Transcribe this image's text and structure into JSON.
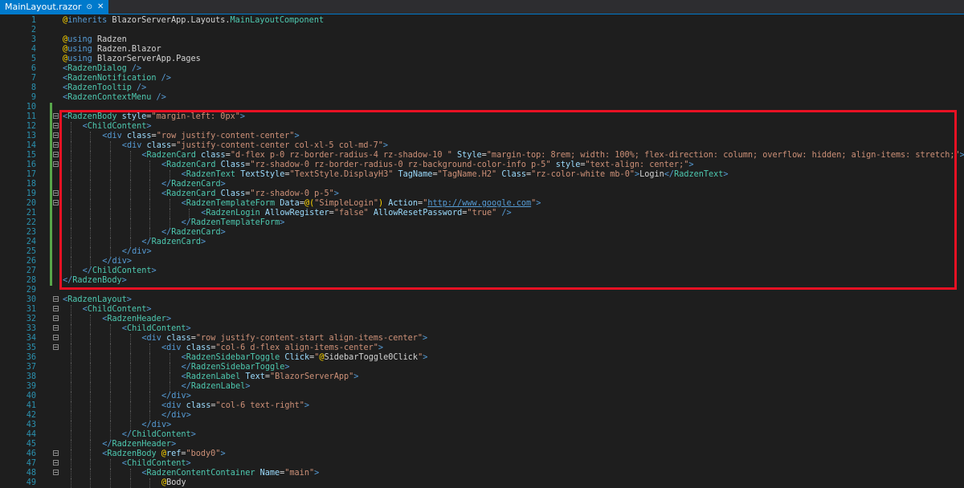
{
  "tab": {
    "title": "MainLayout.razor"
  },
  "colors": {
    "tab_bg": "#007acc",
    "highlight": "#e81123",
    "change_bar": "#57a64a"
  },
  "lines": [
    {
      "n": "1",
      "indent": 0,
      "fold": false,
      "tokens": [
        [
          "at",
          "@"
        ],
        [
          "k",
          "inherits "
        ],
        [
          "d",
          "BlazorServerApp.Layouts."
        ],
        [
          "t",
          "MainLayoutComponent"
        ]
      ]
    },
    {
      "n": "2",
      "indent": 0,
      "fold": false,
      "tokens": []
    },
    {
      "n": "3",
      "indent": 0,
      "fold": false,
      "tokens": [
        [
          "at",
          "@"
        ],
        [
          "k",
          "using "
        ],
        [
          "d",
          "Radzen"
        ]
      ]
    },
    {
      "n": "4",
      "indent": 0,
      "fold": false,
      "tokens": [
        [
          "at",
          "@"
        ],
        [
          "k",
          "using "
        ],
        [
          "d",
          "Radzen.Blazor"
        ]
      ]
    },
    {
      "n": "5",
      "indent": 0,
      "fold": false,
      "tokens": [
        [
          "at",
          "@"
        ],
        [
          "k",
          "using "
        ],
        [
          "d",
          "BlazorServerApp.Pages"
        ]
      ]
    },
    {
      "n": "6",
      "indent": 0,
      "fold": false,
      "tokens": [
        [
          "k",
          "<"
        ],
        [
          "t",
          "RadzenDialog"
        ],
        [
          "k",
          " />"
        ]
      ]
    },
    {
      "n": "7",
      "indent": 0,
      "fold": false,
      "tokens": [
        [
          "k",
          "<"
        ],
        [
          "t",
          "RadzenNotification"
        ],
        [
          "k",
          " />"
        ]
      ]
    },
    {
      "n": "8",
      "indent": 0,
      "fold": false,
      "tokens": [
        [
          "k",
          "<"
        ],
        [
          "t",
          "RadzenTooltip"
        ],
        [
          "k",
          " />"
        ]
      ]
    },
    {
      "n": "9",
      "indent": 0,
      "fold": false,
      "tokens": [
        [
          "k",
          "<"
        ],
        [
          "t",
          "RadzenContextMenu"
        ],
        [
          "k",
          " />"
        ]
      ]
    },
    {
      "n": "10",
      "indent": 0,
      "fold": false,
      "tokens": []
    },
    {
      "n": "11",
      "indent": 0,
      "fold": true,
      "tokens": [
        [
          "k",
          "<"
        ],
        [
          "t",
          "RadzenBody"
        ],
        [
          "a",
          " style"
        ],
        [
          "d",
          "="
        ],
        [
          "s",
          "\"margin-left: 0px\""
        ],
        [
          "k",
          ">"
        ]
      ]
    },
    {
      "n": "12",
      "indent": 1,
      "fold": true,
      "tokens": [
        [
          "k",
          "<"
        ],
        [
          "t",
          "ChildContent"
        ],
        [
          "k",
          ">"
        ]
      ]
    },
    {
      "n": "13",
      "indent": 2,
      "fold": true,
      "tokens": [
        [
          "k",
          "<"
        ],
        [
          "k",
          "div"
        ],
        [
          "a",
          " class"
        ],
        [
          "d",
          "="
        ],
        [
          "s",
          "\"row justify-content-center\""
        ],
        [
          "k",
          ">"
        ]
      ]
    },
    {
      "n": "14",
      "indent": 3,
      "fold": true,
      "tokens": [
        [
          "k",
          "<"
        ],
        [
          "k",
          "div"
        ],
        [
          "a",
          " class"
        ],
        [
          "d",
          "="
        ],
        [
          "s",
          "\"justify-content-center col-xl-5 col-md-7\""
        ],
        [
          "k",
          ">"
        ]
      ]
    },
    {
      "n": "15",
      "indent": 4,
      "fold": true,
      "tokens": [
        [
          "k",
          "<"
        ],
        [
          "t",
          "RadzenCard"
        ],
        [
          "a",
          " class"
        ],
        [
          "d",
          "="
        ],
        [
          "s",
          "\"d-flex p-0 rz-border-radius-4 rz-shadow-10 \""
        ],
        [
          "a",
          " Style"
        ],
        [
          "d",
          "="
        ],
        [
          "s",
          "\"margin-top: 8rem; width: 100%; flex-direction: column; overflow: hidden; align-items: stretch;\""
        ],
        [
          "k",
          ">"
        ]
      ]
    },
    {
      "n": "16",
      "indent": 5,
      "fold": true,
      "tokens": [
        [
          "k",
          "<"
        ],
        [
          "t",
          "RadzenCard"
        ],
        [
          "a",
          " Class"
        ],
        [
          "d",
          "="
        ],
        [
          "s",
          "\"rz-shadow-0 rz-border-radius-0 rz-background-color-info p-5\""
        ],
        [
          "a",
          " style"
        ],
        [
          "d",
          "="
        ],
        [
          "s",
          "\"text-align: center;\""
        ],
        [
          "k",
          ">"
        ]
      ]
    },
    {
      "n": "17",
      "indent": 6,
      "fold": false,
      "tokens": [
        [
          "k",
          "<"
        ],
        [
          "t",
          "RadzenText"
        ],
        [
          "a",
          " TextStyle"
        ],
        [
          "d",
          "="
        ],
        [
          "s",
          "\"TextStyle.DisplayH3\""
        ],
        [
          "a",
          " TagName"
        ],
        [
          "d",
          "="
        ],
        [
          "s",
          "\"TagName.H2\""
        ],
        [
          "a",
          " Class"
        ],
        [
          "d",
          "="
        ],
        [
          "s",
          "\"rz-color-white mb-0\""
        ],
        [
          "k",
          ">"
        ],
        [
          "d",
          "Login"
        ],
        [
          "k",
          "</"
        ],
        [
          "t",
          "RadzenText"
        ],
        [
          "k",
          ">"
        ]
      ]
    },
    {
      "n": "18",
      "indent": 5,
      "fold": false,
      "tokens": [
        [
          "k",
          "</"
        ],
        [
          "t",
          "RadzenCard"
        ],
        [
          "k",
          ">"
        ]
      ]
    },
    {
      "n": "19",
      "indent": 5,
      "fold": true,
      "tokens": [
        [
          "k",
          "<"
        ],
        [
          "t",
          "RadzenCard"
        ],
        [
          "a",
          " Class"
        ],
        [
          "d",
          "="
        ],
        [
          "s",
          "\"rz-shadow-0 p-5\""
        ],
        [
          "k",
          ">"
        ]
      ]
    },
    {
      "n": "20",
      "indent": 6,
      "fold": true,
      "tokens": [
        [
          "k",
          "<"
        ],
        [
          "t",
          "RadzenTemplateForm"
        ],
        [
          "a",
          " Data"
        ],
        [
          "d",
          "="
        ],
        [
          "at",
          "@("
        ],
        [
          "s",
          "\"SimpleLogin\""
        ],
        [
          "at",
          ")"
        ],
        [
          "a",
          " Action"
        ],
        [
          "d",
          "="
        ],
        [
          "s",
          "\""
        ],
        [
          "u",
          "http://www.google.com"
        ],
        [
          "s",
          "\""
        ],
        [
          "k",
          ">"
        ]
      ]
    },
    {
      "n": "21",
      "indent": 7,
      "fold": false,
      "tokens": [
        [
          "k",
          "<"
        ],
        [
          "t",
          "RadzenLogin"
        ],
        [
          "a",
          " AllowRegister"
        ],
        [
          "d",
          "="
        ],
        [
          "s",
          "\"false\""
        ],
        [
          "a",
          " AllowResetPassword"
        ],
        [
          "d",
          "="
        ],
        [
          "s",
          "\"true\""
        ],
        [
          "k",
          " />"
        ]
      ]
    },
    {
      "n": "22",
      "indent": 6,
      "fold": false,
      "tokens": [
        [
          "k",
          "</"
        ],
        [
          "t",
          "RadzenTemplateForm"
        ],
        [
          "k",
          ">"
        ]
      ]
    },
    {
      "n": "23",
      "indent": 5,
      "fold": false,
      "tokens": [
        [
          "k",
          "</"
        ],
        [
          "t",
          "RadzenCard"
        ],
        [
          "k",
          ">"
        ]
      ]
    },
    {
      "n": "24",
      "indent": 4,
      "fold": false,
      "tokens": [
        [
          "k",
          "</"
        ],
        [
          "t",
          "RadzenCard"
        ],
        [
          "k",
          ">"
        ]
      ]
    },
    {
      "n": "25",
      "indent": 3,
      "fold": false,
      "tokens": [
        [
          "k",
          "</"
        ],
        [
          "k",
          "div"
        ],
        [
          "k",
          ">"
        ]
      ]
    },
    {
      "n": "26",
      "indent": 2,
      "fold": false,
      "tokens": [
        [
          "k",
          "</"
        ],
        [
          "k",
          "div"
        ],
        [
          "k",
          ">"
        ]
      ]
    },
    {
      "n": "27",
      "indent": 1,
      "fold": false,
      "tokens": [
        [
          "k",
          "</"
        ],
        [
          "t",
          "ChildContent"
        ],
        [
          "k",
          ">"
        ]
      ]
    },
    {
      "n": "28",
      "indent": 0,
      "fold": false,
      "tokens": [
        [
          "k",
          "</"
        ],
        [
          "t",
          "RadzenBody"
        ],
        [
          "k",
          ">"
        ]
      ]
    },
    {
      "n": "29",
      "indent": 0,
      "fold": false,
      "tokens": []
    },
    {
      "n": "30",
      "indent": 0,
      "fold": true,
      "tokens": [
        [
          "k",
          "<"
        ],
        [
          "t",
          "RadzenLayout"
        ],
        [
          "k",
          ">"
        ]
      ]
    },
    {
      "n": "31",
      "indent": 1,
      "fold": true,
      "tokens": [
        [
          "k",
          "<"
        ],
        [
          "t",
          "ChildContent"
        ],
        [
          "k",
          ">"
        ]
      ]
    },
    {
      "n": "32",
      "indent": 2,
      "fold": true,
      "tokens": [
        [
          "k",
          "<"
        ],
        [
          "t",
          "RadzenHeader"
        ],
        [
          "k",
          ">"
        ]
      ]
    },
    {
      "n": "33",
      "indent": 3,
      "fold": true,
      "tokens": [
        [
          "k",
          "<"
        ],
        [
          "t",
          "ChildContent"
        ],
        [
          "k",
          ">"
        ]
      ]
    },
    {
      "n": "34",
      "indent": 4,
      "fold": true,
      "tokens": [
        [
          "k",
          "<"
        ],
        [
          "k",
          "div"
        ],
        [
          "a",
          " class"
        ],
        [
          "d",
          "="
        ],
        [
          "s",
          "\"row justify-content-start align-items-center\""
        ],
        [
          "k",
          ">"
        ]
      ]
    },
    {
      "n": "35",
      "indent": 5,
      "fold": true,
      "tokens": [
        [
          "k",
          "<"
        ],
        [
          "k",
          "div"
        ],
        [
          "a",
          " class"
        ],
        [
          "d",
          "="
        ],
        [
          "s",
          "\"col-6 d-flex align-items-center\""
        ],
        [
          "k",
          ">"
        ]
      ]
    },
    {
      "n": "36",
      "indent": 6,
      "fold": false,
      "tokens": [
        [
          "k",
          "<"
        ],
        [
          "t",
          "RadzenSidebarToggle"
        ],
        [
          "a",
          " Click"
        ],
        [
          "d",
          "="
        ],
        [
          "s",
          "\""
        ],
        [
          "at",
          "@"
        ],
        [
          "d",
          "SidebarToggle0Click"
        ],
        [
          "s",
          "\""
        ],
        [
          "k",
          ">"
        ]
      ]
    },
    {
      "n": "37",
      "indent": 6,
      "fold": false,
      "tokens": [
        [
          "k",
          "</"
        ],
        [
          "t",
          "RadzenSidebarToggle"
        ],
        [
          "k",
          ">"
        ]
      ]
    },
    {
      "n": "38",
      "indent": 6,
      "fold": false,
      "tokens": [
        [
          "k",
          "<"
        ],
        [
          "t",
          "RadzenLabel"
        ],
        [
          "a",
          " Text"
        ],
        [
          "d",
          "="
        ],
        [
          "s",
          "\"BlazorServerApp\""
        ],
        [
          "k",
          ">"
        ]
      ]
    },
    {
      "n": "39",
      "indent": 6,
      "fold": false,
      "tokens": [
        [
          "k",
          "</"
        ],
        [
          "t",
          "RadzenLabel"
        ],
        [
          "k",
          ">"
        ]
      ]
    },
    {
      "n": "40",
      "indent": 5,
      "fold": false,
      "tokens": [
        [
          "k",
          "</"
        ],
        [
          "k",
          "div"
        ],
        [
          "k",
          ">"
        ]
      ]
    },
    {
      "n": "41",
      "indent": 5,
      "fold": false,
      "tokens": [
        [
          "k",
          "<"
        ],
        [
          "k",
          "div"
        ],
        [
          "a",
          " class"
        ],
        [
          "d",
          "="
        ],
        [
          "s",
          "\"col-6 text-right\""
        ],
        [
          "k",
          ">"
        ]
      ]
    },
    {
      "n": "42",
      "indent": 5,
      "fold": false,
      "tokens": [
        [
          "k",
          "</"
        ],
        [
          "k",
          "div"
        ],
        [
          "k",
          ">"
        ]
      ]
    },
    {
      "n": "43",
      "indent": 4,
      "fold": false,
      "tokens": [
        [
          "k",
          "</"
        ],
        [
          "k",
          "div"
        ],
        [
          "k",
          ">"
        ]
      ]
    },
    {
      "n": "44",
      "indent": 3,
      "fold": false,
      "tokens": [
        [
          "k",
          "</"
        ],
        [
          "t",
          "ChildContent"
        ],
        [
          "k",
          ">"
        ]
      ]
    },
    {
      "n": "45",
      "indent": 2,
      "fold": false,
      "tokens": [
        [
          "k",
          "</"
        ],
        [
          "t",
          "RadzenHeader"
        ],
        [
          "k",
          ">"
        ]
      ]
    },
    {
      "n": "46",
      "indent": 2,
      "fold": true,
      "tokens": [
        [
          "k",
          "<"
        ],
        [
          "t",
          "RadzenBody"
        ],
        [
          "at",
          " @"
        ],
        [
          "a",
          "ref"
        ],
        [
          "d",
          "="
        ],
        [
          "s",
          "\"body0\""
        ],
        [
          "k",
          ">"
        ]
      ]
    },
    {
      "n": "47",
      "indent": 3,
      "fold": true,
      "tokens": [
        [
          "k",
          "<"
        ],
        [
          "t",
          "ChildContent"
        ],
        [
          "k",
          ">"
        ]
      ]
    },
    {
      "n": "48",
      "indent": 4,
      "fold": true,
      "tokens": [
        [
          "k",
          "<"
        ],
        [
          "t",
          "RadzenContentContainer"
        ],
        [
          "a",
          " Name"
        ],
        [
          "d",
          "="
        ],
        [
          "s",
          "\"main\""
        ],
        [
          "k",
          ">"
        ]
      ]
    },
    {
      "n": "49",
      "indent": 5,
      "fold": false,
      "tokens": [
        [
          "at",
          "@"
        ],
        [
          "d",
          "Body"
        ]
      ]
    }
  ]
}
